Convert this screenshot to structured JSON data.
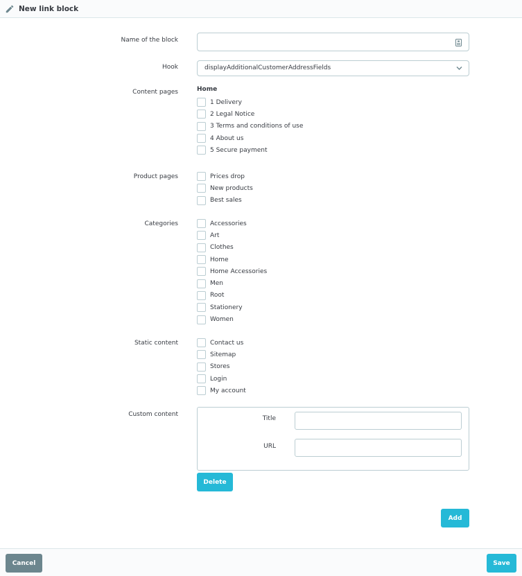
{
  "header": {
    "title": "New link block",
    "icon": "pencil-icon"
  },
  "form": {
    "name_label": "Name of the block",
    "name_value": "",
    "name_addon_icon": "language-icon",
    "hook_label": "Hook",
    "hook_value": "displayAdditionalCustomerAddressFields",
    "content_pages": {
      "label": "Content pages",
      "group_title": "Home",
      "items": [
        {
          "label": "1 Delivery",
          "checked": false
        },
        {
          "label": "2 Legal Notice",
          "checked": false
        },
        {
          "label": "3 Terms and conditions of use",
          "checked": false
        },
        {
          "label": "4 About us",
          "checked": false
        },
        {
          "label": "5 Secure payment",
          "checked": false
        }
      ]
    },
    "product_pages": {
      "label": "Product pages",
      "items": [
        {
          "label": "Prices drop",
          "checked": false
        },
        {
          "label": "New products",
          "checked": false
        },
        {
          "label": "Best sales",
          "checked": false
        }
      ]
    },
    "categories": {
      "label": "Categories",
      "items": [
        {
          "label": "Accessories",
          "checked": false
        },
        {
          "label": "Art",
          "checked": false
        },
        {
          "label": "Clothes",
          "checked": false
        },
        {
          "label": "Home",
          "checked": false
        },
        {
          "label": "Home Accessories",
          "checked": false
        },
        {
          "label": "Men",
          "checked": false
        },
        {
          "label": "Root",
          "checked": false
        },
        {
          "label": "Stationery",
          "checked": false
        },
        {
          "label": "Women",
          "checked": false
        }
      ]
    },
    "static_content": {
      "label": "Static content",
      "items": [
        {
          "label": "Contact us",
          "checked": false
        },
        {
          "label": "Sitemap",
          "checked": false
        },
        {
          "label": "Stores",
          "checked": false
        },
        {
          "label": "Login",
          "checked": false
        },
        {
          "label": "My account",
          "checked": false
        }
      ]
    },
    "custom_content": {
      "label": "Custom content",
      "title_label": "Title",
      "title_value": "",
      "url_label": "URL",
      "url_value": "",
      "delete_label": "Delete"
    },
    "add_label": "Add"
  },
  "footer": {
    "cancel_label": "Cancel",
    "save_label": "Save"
  },
  "colors": {
    "primary": "#25b9d7",
    "secondary": "#6c868e",
    "border": "#bbcdd2",
    "text": "#363a41"
  }
}
